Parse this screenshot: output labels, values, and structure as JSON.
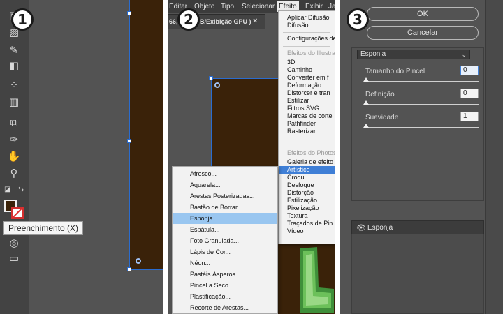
{
  "panel1": {
    "step": "1",
    "tooltip": "Preenchimento (X)",
    "fill_color": "#3a2209",
    "tools": [
      "selection-icon",
      "gradient-icon",
      "eyedropper-icon",
      "blend-icon",
      "symbol-sprayer-icon",
      "graph-icon",
      "artboard-icon",
      "slice-icon",
      "hand-icon",
      "zoom-icon",
      "default-colors-icon",
      "swap-colors-icon",
      "draw-mode-icon",
      "screen-mode-icon"
    ]
  },
  "panel2": {
    "step": "2",
    "menubar": {
      "items": [
        "Editar",
        "Objeto",
        "Tipo",
        "Selecionar",
        "Efeito",
        "Exibir",
        "Ja"
      ]
    },
    "doc_tab": {
      "zoom": "66,6",
      "mode": "B/Exibição GPU )",
      "close": "×"
    },
    "effect_menu": {
      "top": [
        "Aplicar Difusão",
        "Difusão..."
      ],
      "config": "Configurações de",
      "illustrator_header": "Efeitos do Illustra",
      "illustrator_items": [
        "3D",
        "Caminho",
        "Converter em f",
        "Deformação",
        "Distorcer e tran",
        "Estilizar",
        "Filtros SVG",
        "Marcas de corte",
        "Pathfinder",
        "Rasterizar..."
      ],
      "photoshop_header": "Efeitos do Photos",
      "photoshop_items": [
        "Galeria de efeito",
        "Artístico",
        "Croqui",
        "Desfoque",
        "Distorção",
        "Estilização",
        "Pixelização",
        "Textura",
        "Traçados de Pin",
        "Vídeo"
      ],
      "selected": "Artístico"
    },
    "artistic_submenu": {
      "items": [
        "Afresco...",
        "Aquarela...",
        "Arestas Posterizadas...",
        "Bastão de Borrar...",
        "Esponja...",
        "Espátula...",
        "Foto Granulada...",
        "Lápis de Cor...",
        "Néon...",
        "Pastéis Ásperos...",
        "Pincel a Seco...",
        "Plastificação...",
        "Recorte de Arestas..."
      ],
      "selected": "Esponja..."
    }
  },
  "panel3": {
    "step": "3",
    "ok_label": "OK",
    "cancel_label": "Cancelar",
    "filter_select": "Esponja",
    "options": [
      {
        "label": "Tamanho do Pincel",
        "value": "0"
      },
      {
        "label": "Definição",
        "value": "0"
      },
      {
        "label": "Suavidade",
        "value": "1"
      }
    ],
    "layer_name": "Esponja"
  }
}
